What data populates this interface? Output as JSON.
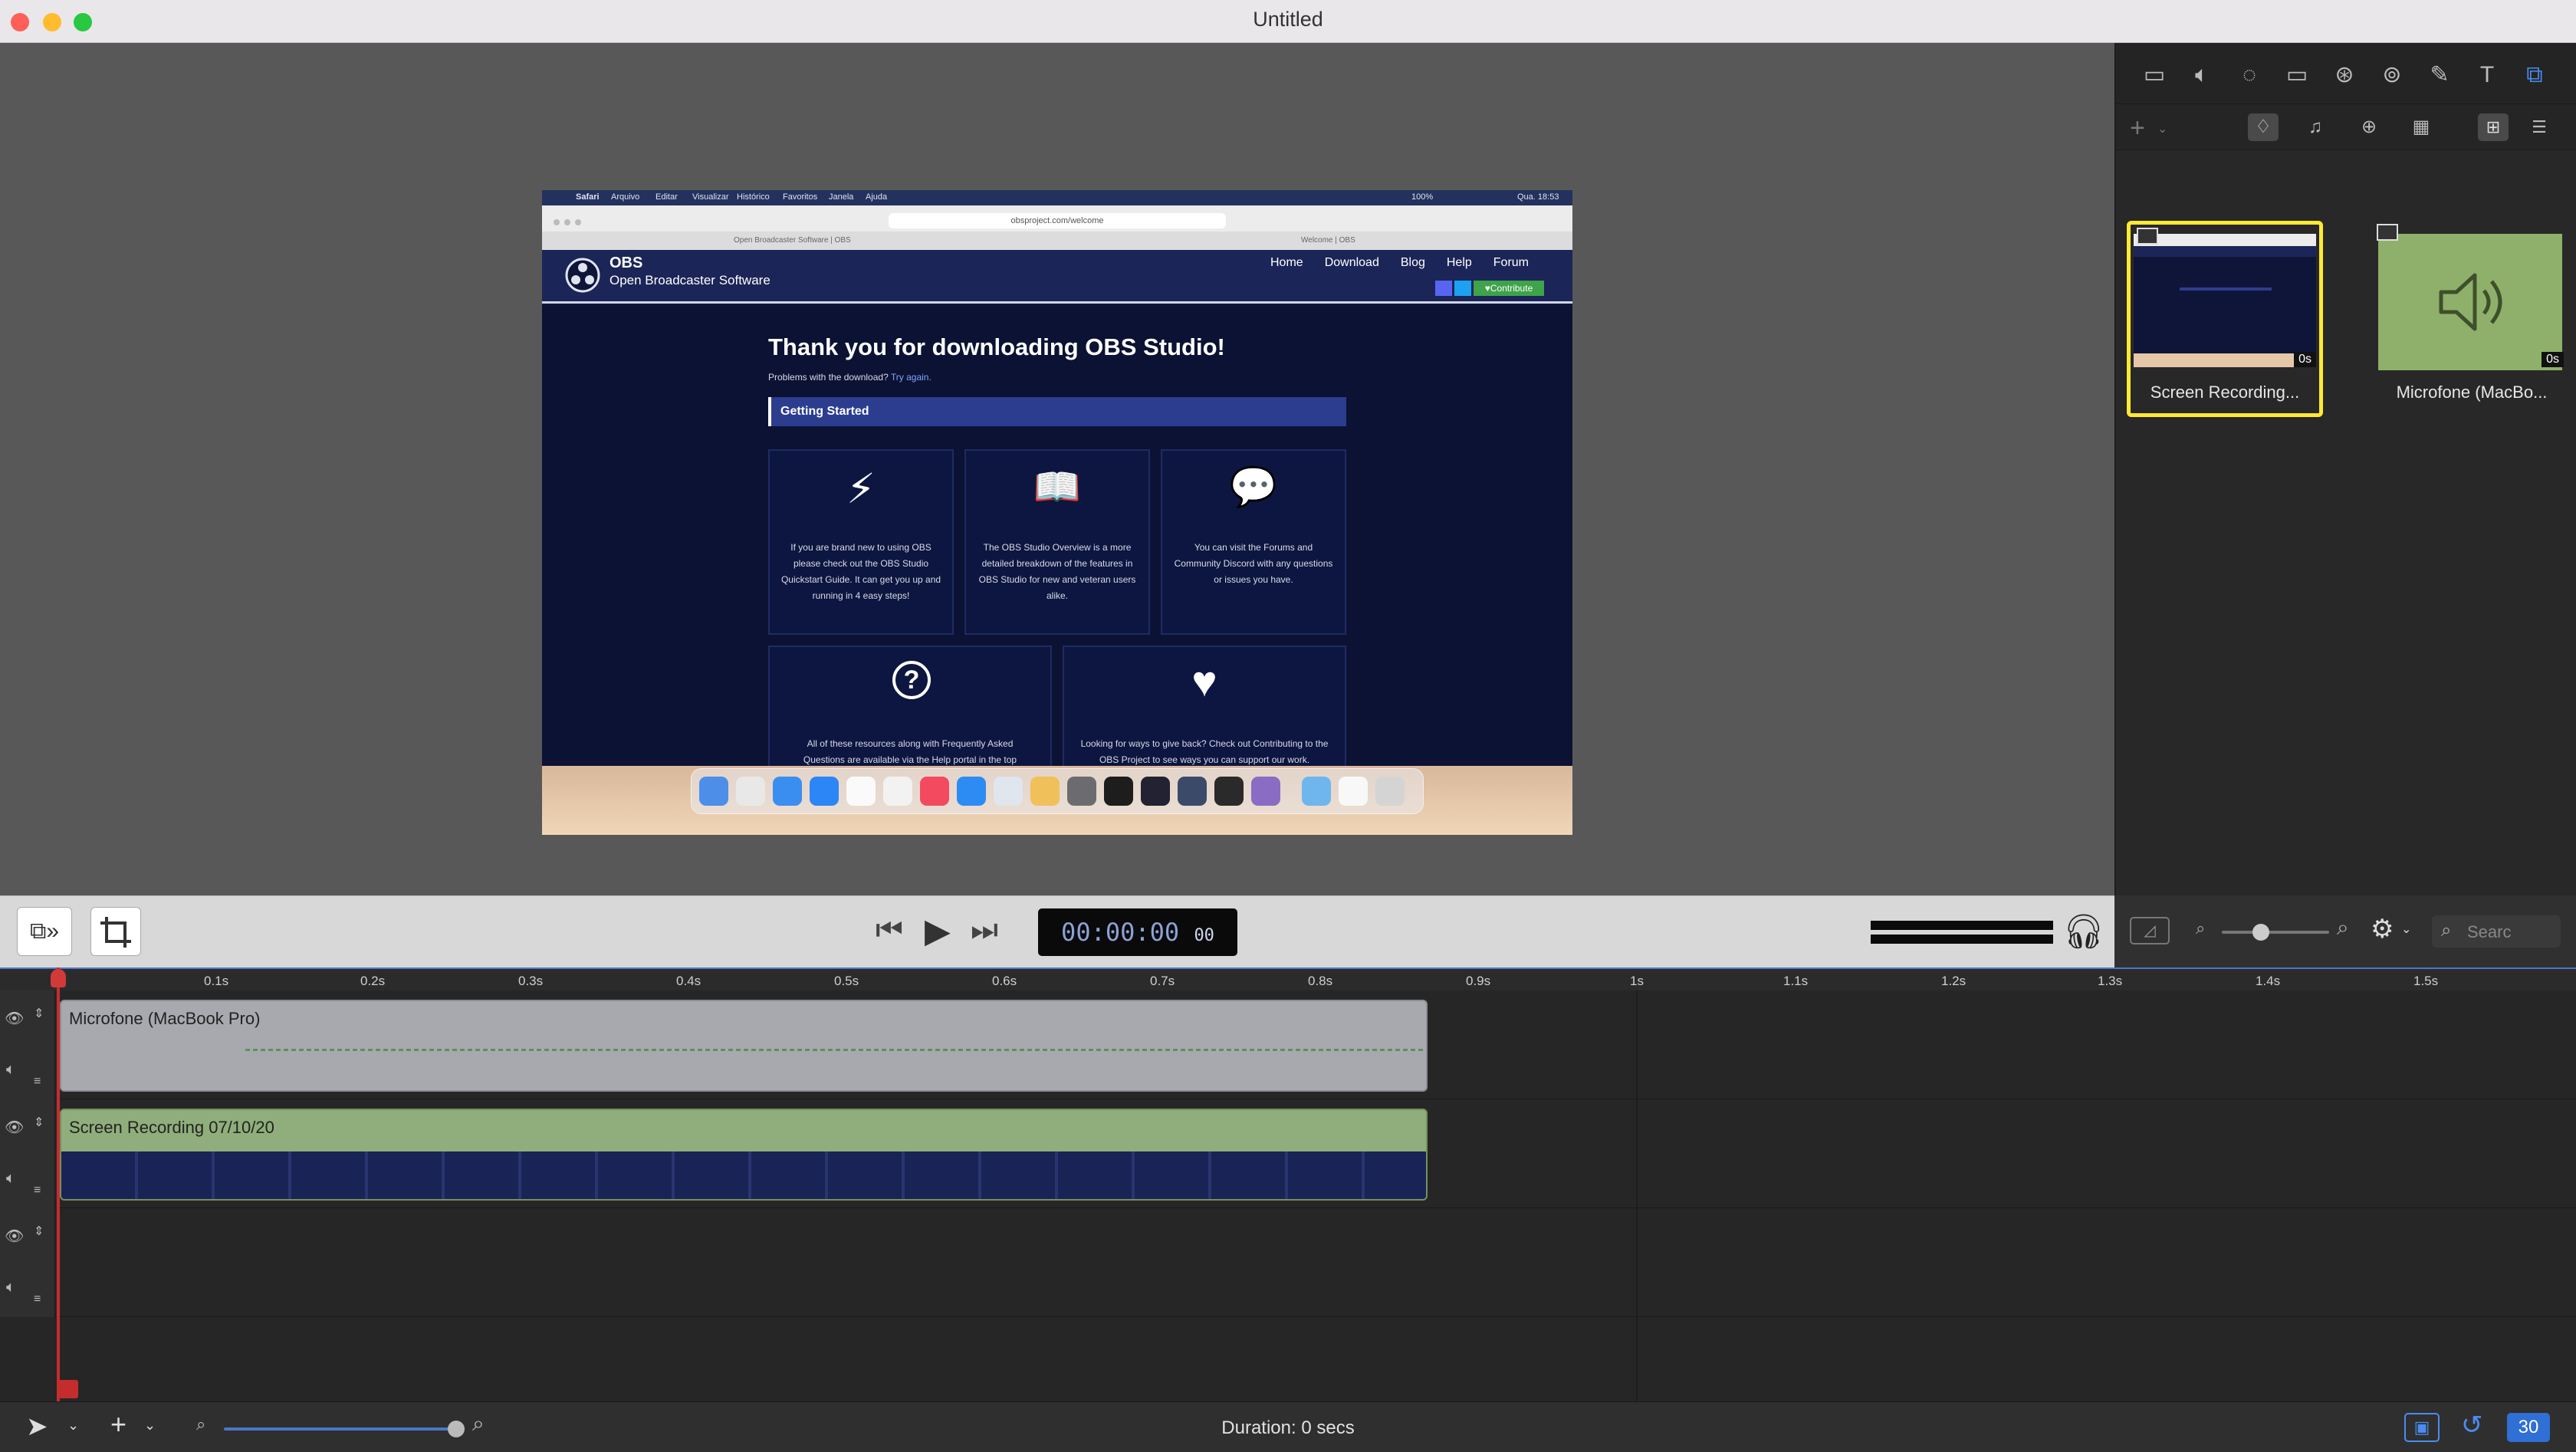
{
  "window": {
    "title": "Untitled"
  },
  "recorded_screen": {
    "menubar": {
      "app": "Safari",
      "items": [
        "Arquivo",
        "Editar",
        "Visualizar",
        "Histórico",
        "Favoritos",
        "Janela",
        "Ajuda"
      ],
      "clock": "Qua. 18:53",
      "battery": "100%"
    },
    "url": "obsproject.com/welcome",
    "tabs": [
      "Open Broadcaster Software | OBS",
      "Welcome | OBS"
    ],
    "site": {
      "brand": "OBS",
      "brand_sub": "Open Broadcaster Software",
      "nav": [
        "Home",
        "Download",
        "Blog",
        "Help",
        "Forum"
      ],
      "contribute": "♥Contribute",
      "heading": "Thank you for downloading OBS Studio!",
      "problems": "Problems with the download?",
      "try_again": "Try again.",
      "section": "Getting Started",
      "cards": [
        {
          "icon": "⚡",
          "text": "If you are brand new to using OBS please check out the OBS Studio Quickstart Guide. It can get you up and running in 4 easy steps!"
        },
        {
          "icon": "📖",
          "text": "The OBS Studio Overview is a more detailed breakdown of the features in OBS Studio for new and veteran users alike."
        },
        {
          "icon": "💬",
          "text": "You can visit the Forums and Community Discord with any questions or issues you have."
        },
        {
          "icon": "?",
          "text": "All of these resources along with Frequently Asked Questions are available via the Help portal in the top navigation bar."
        },
        {
          "icon": "♥",
          "text": "Looking for ways to give back? Check out Contributing to the OBS Project to see ways you can support our work."
        }
      ]
    }
  },
  "media_panel": {
    "items": [
      {
        "name": "Screen Recording...",
        "duration": "0s",
        "selected": true
      },
      {
        "name": "Microfone (MacBo...",
        "duration": "0s",
        "selected": false
      }
    ],
    "search_placeholder": "Searc"
  },
  "transport": {
    "timecode": "00:00:00",
    "frames": "00"
  },
  "ruler": {
    "ticks": [
      "0.1s",
      "0.2s",
      "0.3s",
      "0.4s",
      "0.5s",
      "0.6s",
      "0.7s",
      "0.8s",
      "0.9s",
      "1s",
      "1.1s",
      "1.2s",
      "1.3s",
      "1.4s",
      "1.5s"
    ]
  },
  "tracks": [
    {
      "clip": "Microfone (MacBook Pro)",
      "kind": "audio"
    },
    {
      "clip": "Screen Recording 07/10/20",
      "kind": "video"
    }
  ],
  "status": {
    "duration": "Duration: 0 secs",
    "fps": "30"
  },
  "colors": {
    "accent": "#4a78c8",
    "selection": "#ffe933",
    "audio_clip": "#a7a9ae",
    "video_clip": "#8fae7b",
    "playhead": "#c52d2d"
  }
}
